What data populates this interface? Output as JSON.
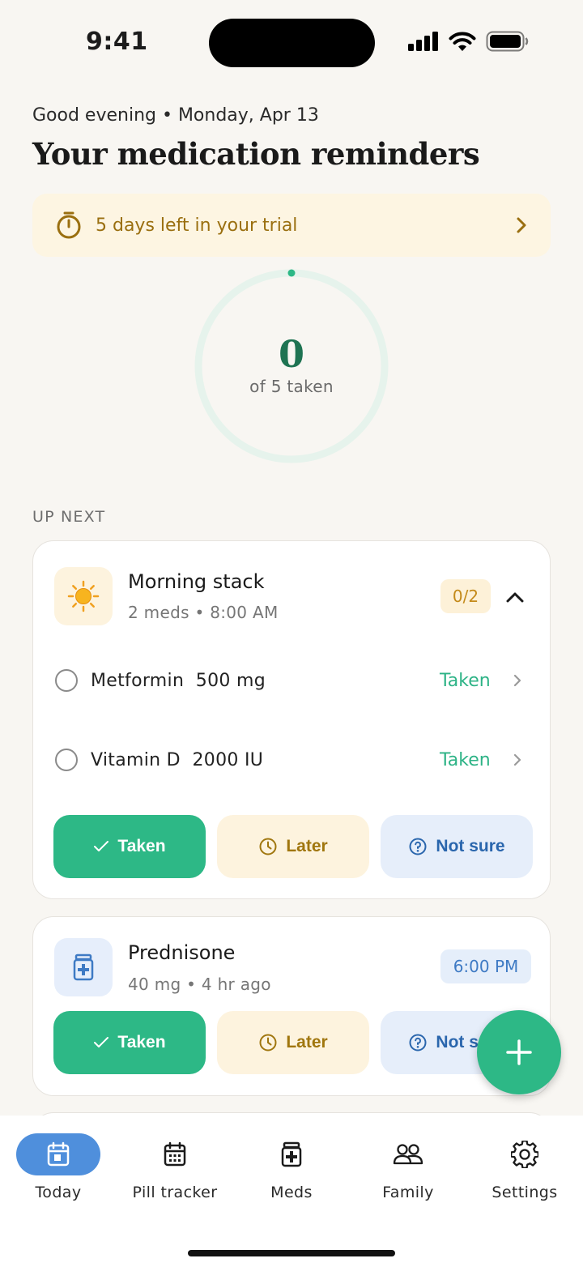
{
  "status_bar": {
    "time": "9:41"
  },
  "header": {
    "greeting": "Good evening • Monday, Apr 13",
    "title": "Your medication reminders"
  },
  "trial_banner": {
    "text": "5 days left in your trial",
    "icon": "timer-icon"
  },
  "progress": {
    "taken": 0,
    "total": 5,
    "count_text": "0",
    "label": "of 5 taken"
  },
  "section_label": "UP NEXT",
  "groups": [
    {
      "title": "Morning stack",
      "subtitle": "2 meds • 8:00 AM",
      "badge": "0/2",
      "icon": "sun-icon",
      "meds": [
        {
          "name": "Metformin  500 mg",
          "status": "Taken"
        },
        {
          "name": "Vitamin D  2000 IU",
          "status": "Taken"
        }
      ],
      "actions": {
        "taken": "Taken",
        "later": "Later",
        "unsure": "Not sure"
      }
    },
    {
      "title": "Prednisone",
      "subtitle": "40 mg • 4 hr ago",
      "badge": "6:00 PM",
      "icon": "pill-bottle-icon",
      "actions": {
        "taken": "Taken",
        "later": "Later",
        "unsure": "Not sure"
      }
    }
  ],
  "nav": [
    {
      "label": "Today",
      "icon": "calendar-icon",
      "active": true
    },
    {
      "label": "Pill tracker",
      "icon": "calendar-grid-icon"
    },
    {
      "label": "Meds",
      "icon": "pill-bottle-icon"
    },
    {
      "label": "Family",
      "icon": "people-icon"
    },
    {
      "label": "Settings",
      "icon": "gear-icon"
    }
  ],
  "colors": {
    "accent_green": "#2db886",
    "progress_green": "#1e7352",
    "trial_gold": "#9a6f10",
    "active_nav_blue": "#4f8fdc",
    "background": "#f8f6f2"
  }
}
